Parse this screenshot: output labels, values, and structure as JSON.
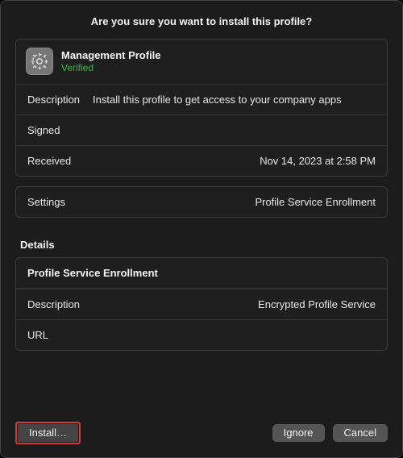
{
  "dialog": {
    "title": "Are you sure you want to install this profile?"
  },
  "profile": {
    "name": "Management Profile",
    "status": "Verified",
    "rows": {
      "description_label": "Description",
      "description_value": "Install this profile to get access to your company apps",
      "signed_label": "Signed",
      "signed_value": "",
      "received_label": "Received",
      "received_value": "Nov 14, 2023 at 2:58 PM"
    }
  },
  "settings": {
    "label": "Settings",
    "value": "Profile Service Enrollment"
  },
  "details": {
    "heading": "Details",
    "enrollment_title": "Profile Service Enrollment",
    "description_label": "Description",
    "description_value": "Encrypted Profile Service",
    "url_label": "URL",
    "url_value": ""
  },
  "buttons": {
    "install": "Install…",
    "ignore": "Ignore",
    "cancel": "Cancel"
  }
}
